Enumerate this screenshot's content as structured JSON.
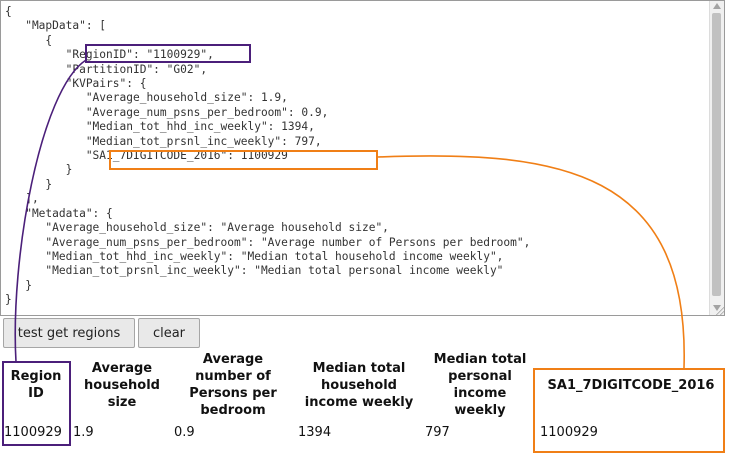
{
  "editor": {
    "json_text": "{\n   \"MapData\": [\n      {\n         \"RegionID\": \"1100929\",\n         \"PartitionID\": \"G02\",\n         \"KVPairs\": {\n            \"Average_household_size\": 1.9,\n            \"Average_num_psns_per_bedroom\": 0.9,\n            \"Median_tot_hhd_inc_weekly\": 1394,\n            \"Median_tot_prsnl_inc_weekly\": 797,\n            \"SA1_7DIGITCODE_2016\": 1100929\n         }\n      }\n   ],\n   \"Metadata\": {\n      \"Average_household_size\": \"Average household size\",\n      \"Average_num_psns_per_bedroom\": \"Average number of Persons per bedroom\",\n      \"Median_tot_hhd_inc_weekly\": \"Median total household income weekly\",\n      \"Median_tot_prsnl_inc_weekly\": \"Median total personal income weekly\"\n   }\n}"
  },
  "buttons": {
    "test_label": "test get regions",
    "clear_label": "clear"
  },
  "table": {
    "headers": [
      "Region ID",
      "Average household size",
      "Average number of Persons per bedroom",
      "Median total household income weekly",
      "Median total personal income weekly",
      "SA1_7DIGITCODE_2016"
    ],
    "row": [
      "1100929",
      "1.9",
      "0.9",
      "1394",
      "797",
      "1100929"
    ]
  },
  "colors": {
    "region_highlight": "#4b1f7a",
    "sa1_highlight": "#f07f16"
  }
}
